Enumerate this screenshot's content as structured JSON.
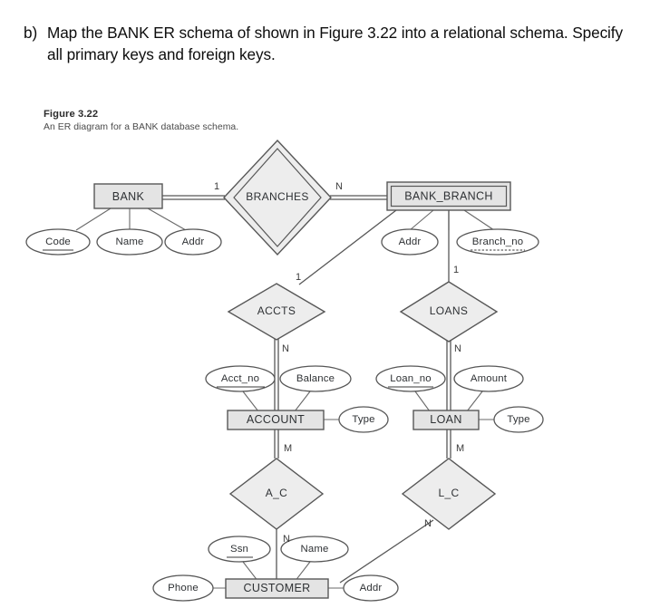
{
  "question": {
    "marker": "b)",
    "text": "Map the BANK ER schema of shown in Figure 3.22 into a relational schema. Specify all primary keys and foreign keys."
  },
  "figure": {
    "number": "Figure 3.22",
    "caption": "An ER diagram for a BANK database schema."
  },
  "colors": {
    "entity_fill": "#e4e4e4",
    "relationship_fill": "#ededed",
    "attribute_fill": "#ffffff",
    "stroke": "#575757",
    "text": "#2e3134",
    "page_background": "#ffffff"
  },
  "diagram": {
    "type": "er-diagram",
    "entities": [
      {
        "id": "bank",
        "name": "BANK",
        "kind": "strong"
      },
      {
        "id": "bank_branch",
        "name": "BANK_BRANCH",
        "kind": "weak"
      },
      {
        "id": "account",
        "name": "ACCOUNT",
        "kind": "strong"
      },
      {
        "id": "loan",
        "name": "LOAN",
        "kind": "strong"
      },
      {
        "id": "customer",
        "name": "CUSTOMER",
        "kind": "strong"
      }
    ],
    "relationships": [
      {
        "id": "branches",
        "name": "BRANCHES",
        "kind": "identifying",
        "between": [
          "BANK",
          "BANK_BRANCH"
        ],
        "cardinality": "1:N"
      },
      {
        "id": "accts",
        "name": "ACCTS",
        "kind": "regular",
        "between": [
          "BANK_BRANCH",
          "ACCOUNT"
        ],
        "cardinality": "1:N"
      },
      {
        "id": "loans",
        "name": "LOANS",
        "kind": "regular",
        "between": [
          "BANK_BRANCH",
          "LOAN"
        ],
        "cardinality": "1:N"
      },
      {
        "id": "a_c",
        "name": "A_C",
        "kind": "regular",
        "between": [
          "ACCOUNT",
          "CUSTOMER"
        ],
        "cardinality": "M:N"
      },
      {
        "id": "l_c",
        "name": "L_C",
        "kind": "regular",
        "between": [
          "LOAN",
          "CUSTOMER"
        ],
        "cardinality": "M:N"
      }
    ],
    "attributes": [
      {
        "owner": "BANK",
        "name": "Code",
        "key": "primary"
      },
      {
        "owner": "BANK",
        "name": "Name",
        "key": "none"
      },
      {
        "owner": "BANK",
        "name": "Addr",
        "key": "none"
      },
      {
        "owner": "BANK_BRANCH",
        "name": "Addr",
        "key": "none"
      },
      {
        "owner": "BANK_BRANCH",
        "name": "Branch_no",
        "key": "partial"
      },
      {
        "owner": "ACCOUNT",
        "name": "Acct_no",
        "key": "primary"
      },
      {
        "owner": "ACCOUNT",
        "name": "Balance",
        "key": "none"
      },
      {
        "owner": "ACCOUNT",
        "name": "Type",
        "key": "none"
      },
      {
        "owner": "LOAN",
        "name": "Loan_no",
        "key": "primary"
      },
      {
        "owner": "LOAN",
        "name": "Amount",
        "key": "none"
      },
      {
        "owner": "LOAN",
        "name": "Type",
        "key": "none"
      },
      {
        "owner": "CUSTOMER",
        "name": "Ssn",
        "key": "primary"
      },
      {
        "owner": "CUSTOMER",
        "name": "Name",
        "key": "none"
      },
      {
        "owner": "CUSTOMER",
        "name": "Addr",
        "key": "none"
      },
      {
        "owner": "CUSTOMER",
        "name": "Phone",
        "key": "none"
      }
    ],
    "cardinality_labels": {
      "bank_branches": "1",
      "branches_bankbranch": "N",
      "bankbranch_accts": "1",
      "accts_account": "N",
      "bankbranch_loans": "1",
      "loans_loan": "N",
      "account_ac": "M",
      "ac_customer": "N",
      "loan_lc": "M",
      "lc_customer": "N"
    },
    "labels": {
      "bank": "BANK",
      "branches": "BRANCHES",
      "bank_branch": "BANK_BRANCH",
      "accts": "ACCTS",
      "loans": "LOANS",
      "account": "ACCOUNT",
      "loan": "LOAN",
      "a_c": "A_C",
      "l_c": "L_C",
      "customer": "CUSTOMER",
      "attr_code": "Code",
      "attr_bank_name": "Name",
      "attr_bank_addr": "Addr",
      "attr_bb_addr": "Addr",
      "attr_branch_no": "Branch_no",
      "attr_acct_no": "Acct_no",
      "attr_balance": "Balance",
      "attr_acct_type": "Type",
      "attr_loan_no": "Loan_no",
      "attr_amount": "Amount",
      "attr_loan_type": "Type",
      "attr_ssn": "Ssn",
      "attr_cust_name": "Name",
      "attr_cust_addr": "Addr",
      "attr_phone": "Phone"
    }
  }
}
